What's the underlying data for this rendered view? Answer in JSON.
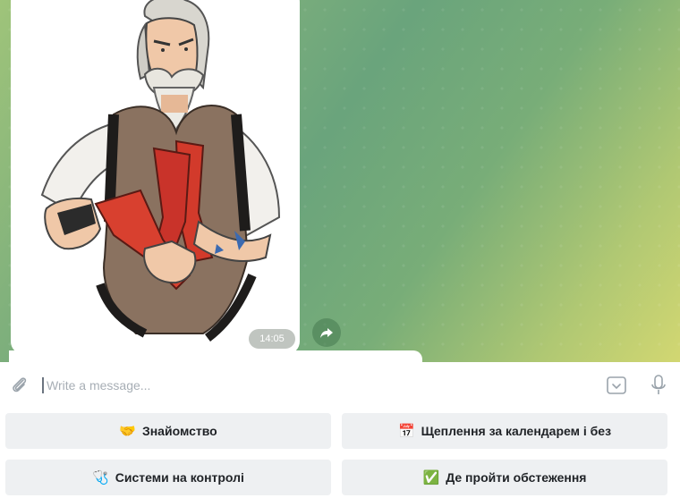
{
  "chat": {
    "message": {
      "time": "14:05"
    }
  },
  "composer": {
    "placeholder": "Write a message..."
  },
  "reply_keyboard": {
    "rows": [
      [
        {
          "emoji": "🤝",
          "label": "Знайомство"
        },
        {
          "emoji": "📅",
          "label": "Щеплення за календарем і без"
        }
      ],
      [
        {
          "emoji": "🩺",
          "label": "Системи на контролі"
        },
        {
          "emoji": "✅",
          "label": "Де пройти обстеження"
        }
      ]
    ]
  },
  "colors": {
    "chat_gradient": [
      "#9fc47a",
      "#6aa47c",
      "#d2d772"
    ],
    "keyboard_button_bg": "#eef0f2",
    "icon_gray": "#9aa3ab"
  },
  "icons": [
    "paperclip-icon",
    "forward-icon",
    "keyboard-icon",
    "microphone-icon"
  ]
}
